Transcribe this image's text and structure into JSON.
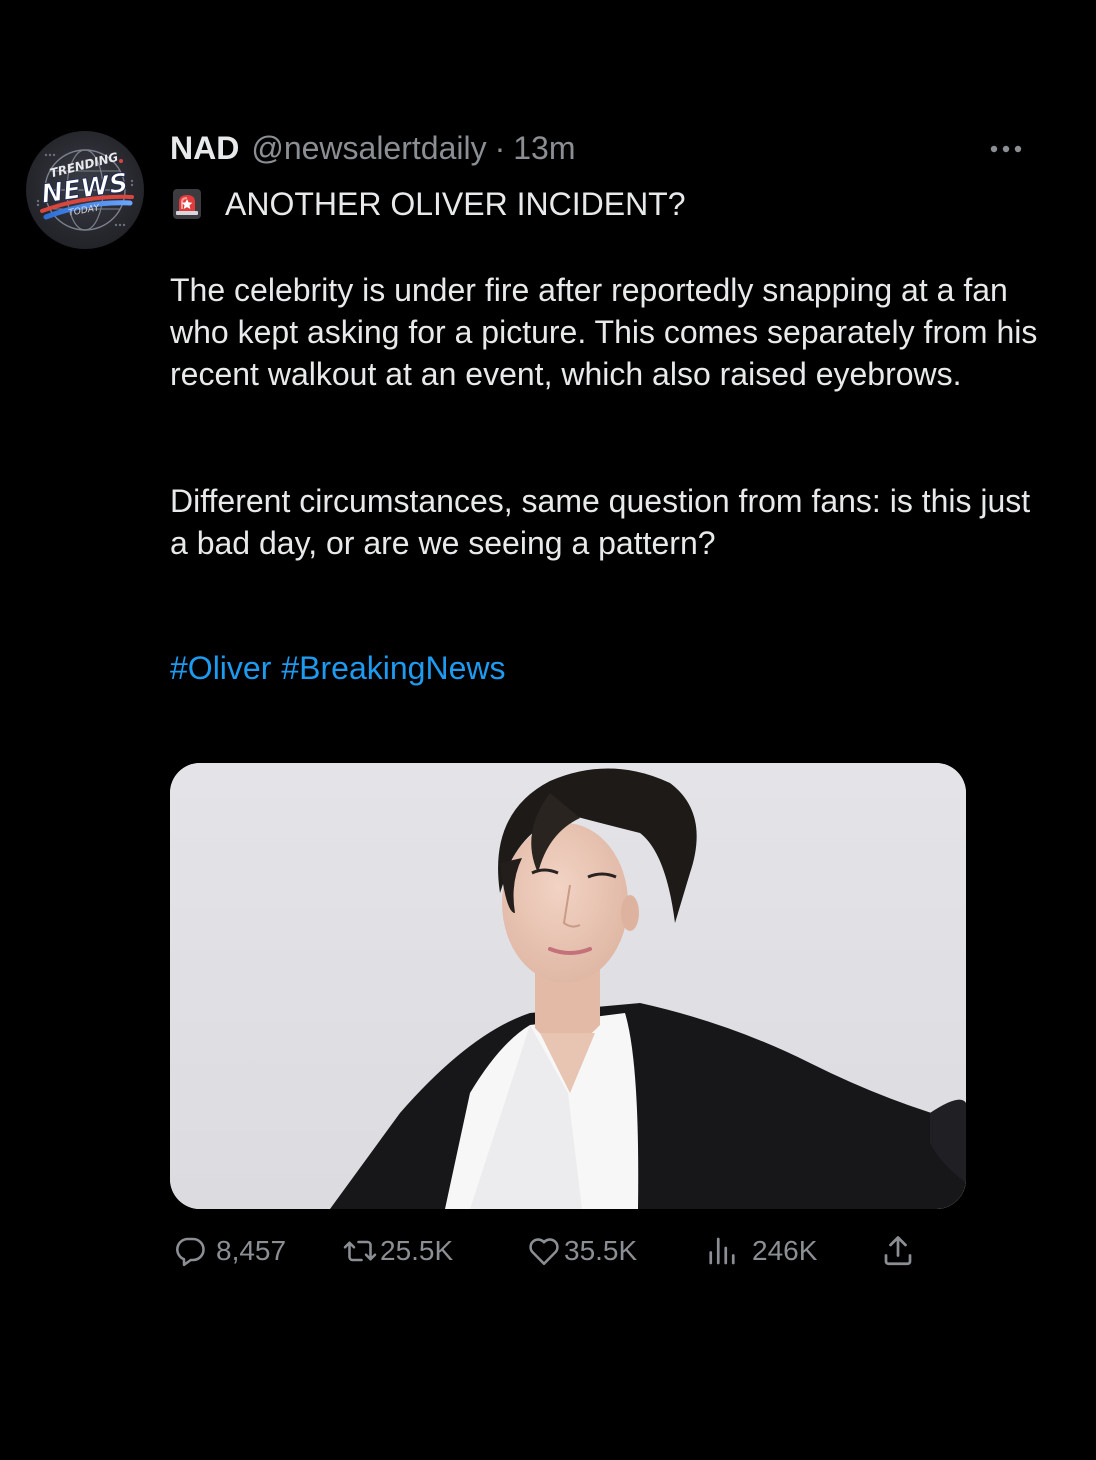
{
  "tweet": {
    "author": {
      "display_name": "NAD",
      "handle": "@newsalertdaily",
      "separator": "·",
      "time": "13m",
      "avatar": {
        "icon": "trending-news-today-logo",
        "logo_text": [
          "TRENDING",
          "NEWS",
          "TODAY"
        ]
      }
    },
    "more_icon": "more-horizontal-icon",
    "headline_icon": "rotating-light-emoji",
    "headline": "ANOTHER OLIVER INCIDENT?",
    "paragraphs": [
      "The celebrity is under fire after reportedly snapping at a fan who kept asking for a picture. This comes separately from his recent walkout at an event, which also raised eyebrows.",
      "Different circumstances, same question from fans: is this just a bad day, or are we seeing a pattern?"
    ],
    "hashtags": [
      "#Oliver",
      "#BreakingNews"
    ],
    "media": {
      "description": "photo"
    },
    "actions": {
      "reply": {
        "icon": "reply-icon",
        "count": "8,457"
      },
      "retweet": {
        "icon": "retweet-icon",
        "count": "25.5K"
      },
      "like": {
        "icon": "heart-icon",
        "count": "35.5K"
      },
      "views": {
        "icon": "views-icon",
        "count": "246K"
      },
      "share": {
        "icon": "share-icon"
      }
    }
  },
  "colors": {
    "background": "#000000",
    "text": "#e7e9ea",
    "secondary": "#8b8f94",
    "accent": "#1d9bf0"
  }
}
